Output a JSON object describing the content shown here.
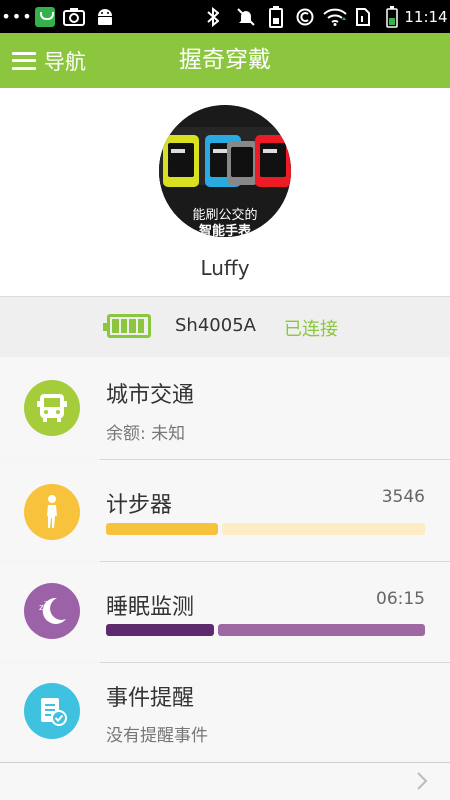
{
  "status_bar": {
    "more_icon": "dots-icon",
    "time": "11:14"
  },
  "header": {
    "nav_label": "导航",
    "title": "握奇穿戴",
    "color": "#8cc63f"
  },
  "profile": {
    "username": "Luffy",
    "avatar_caption_line1": "能刷公交的",
    "avatar_caption_line2": "智能手表"
  },
  "device": {
    "name": "Sh4005A",
    "status": "已连接",
    "battery_level": 1.0
  },
  "rows": {
    "transit": {
      "title": "城市交通",
      "subtitle": "余额: 未知",
      "icon": "bus-icon",
      "color": "#a5cc3b"
    },
    "steps": {
      "title": "计步器",
      "value": "3546",
      "icon": "walking-icon",
      "color": "#f7c23c",
      "progress": 0.35
    },
    "sleep": {
      "title": "睡眠监测",
      "value": "06:15",
      "icon": "moon-icon",
      "color": "#9b62a8",
      "progress": 0.34
    },
    "reminder": {
      "title": "事件提醒",
      "subtitle": "没有提醒事件",
      "icon": "reminder-icon",
      "color": "#3fc1e0"
    }
  }
}
